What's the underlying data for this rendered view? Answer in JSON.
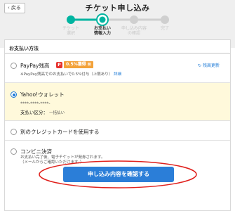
{
  "header": {
    "back_label": "戻る",
    "title": "チケット申し込み"
  },
  "steps": [
    {
      "label": "チケット\n選択",
      "state": "done"
    },
    {
      "label": "お支払い\n情報入力",
      "state": "active"
    },
    {
      "label": "申し込み内容\nの確認",
      "state": "todo"
    },
    {
      "label": "完了",
      "state": "todo"
    }
  ],
  "payment": {
    "section_title": "お支払い方法",
    "options": [
      {
        "id": "paypay",
        "label": "PayPay残高",
        "badge_icon": "P",
        "badge_text": "0.5%獲得 ⊠",
        "note": "※PayPay残高でのお支払いで0.5%付与（上限あり）",
        "note_link": "詳細",
        "refresh_label": "残高更新",
        "selected": false
      },
      {
        "id": "yahoo-wallet",
        "label": "Yahoo!ウォレット",
        "card_masked": "****-****-****-",
        "installment_label": "支払い区分：",
        "installment_value": "一括払い",
        "selected": true
      },
      {
        "id": "other-card",
        "label": "別のクレジットカードを使用する",
        "selected": false
      },
      {
        "id": "convenience",
        "label": "コンビニ決済",
        "note_line1": "お支払い完了後、電子チケットが発券されます。",
        "note_line2": "（メールからご確認いただけます。）",
        "selected": false
      }
    ]
  },
  "submit_label": "申し込み内容を確認する",
  "colors": {
    "accent": "#1e7bd6",
    "step_done": "#00b4a0",
    "annotation": "#e0201c",
    "selected_bg": "#fff9db"
  }
}
